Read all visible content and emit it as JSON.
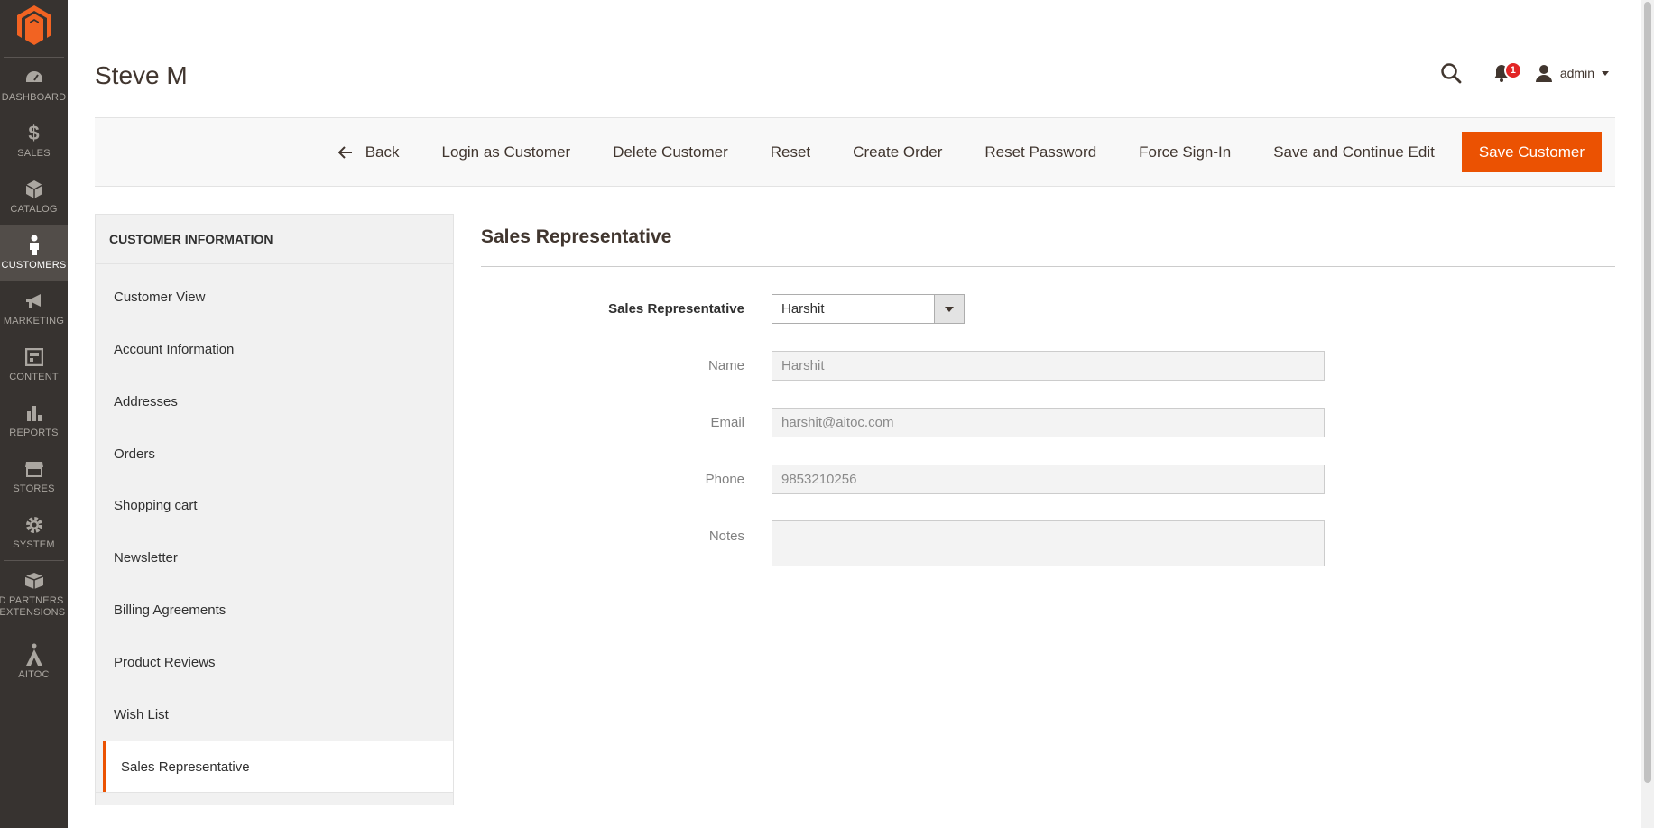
{
  "nav": {
    "items": [
      {
        "key": "dashboard",
        "label": "Dashboard",
        "icon": "dashboard-icon"
      },
      {
        "key": "sales",
        "label": "Sales",
        "icon": "dollar-icon"
      },
      {
        "key": "catalog",
        "label": "Catalog",
        "icon": "cube-icon"
      },
      {
        "key": "customers",
        "label": "Customers",
        "icon": "person-icon"
      },
      {
        "key": "marketing",
        "label": "Marketing",
        "icon": "megaphone-icon"
      },
      {
        "key": "content",
        "label": "Content",
        "icon": "layout-icon"
      },
      {
        "key": "reports",
        "label": "Reports",
        "icon": "bar-chart-icon"
      },
      {
        "key": "stores",
        "label": "Stores",
        "icon": "storefront-icon"
      },
      {
        "key": "system",
        "label": "System",
        "icon": "gear-icon"
      },
      {
        "key": "partners",
        "label": "ND PARTNERS\n& EXTENSIONS",
        "icon": "blocks-icon"
      },
      {
        "key": "aitoc",
        "label": "AITOC",
        "icon": "aitoc-logo-icon"
      }
    ],
    "active": "customers",
    "accent": "#eb5202"
  },
  "header": {
    "title": "Steve M",
    "notifications_count": "1",
    "user": "admin"
  },
  "toolbar": {
    "back": "Back",
    "login_as_customer": "Login as Customer",
    "delete_customer": "Delete Customer",
    "reset": "Reset",
    "create_order": "Create Order",
    "reset_password": "Reset Password",
    "force_sign_in": "Force Sign-In",
    "save_continue": "Save and Continue Edit",
    "save_customer": "Save Customer"
  },
  "sidebar": {
    "title": "CUSTOMER INFORMATION",
    "items": [
      "Customer View",
      "Account Information",
      "Addresses",
      "Orders",
      "Shopping cart",
      "Newsletter",
      "Billing Agreements",
      "Product Reviews",
      "Wish List",
      "Sales Representative"
    ],
    "active": "Sales Representative"
  },
  "form": {
    "section_title": "Sales Representative",
    "rep_label": "Sales Representative",
    "rep_value": "Harshit",
    "name_label": "Name",
    "name_value": "Harshit",
    "email_label": "Email",
    "email_value": "harshit@aitoc.com",
    "phone_label": "Phone",
    "phone_value": "9853210256",
    "notes_label": "Notes",
    "notes_value": ""
  }
}
